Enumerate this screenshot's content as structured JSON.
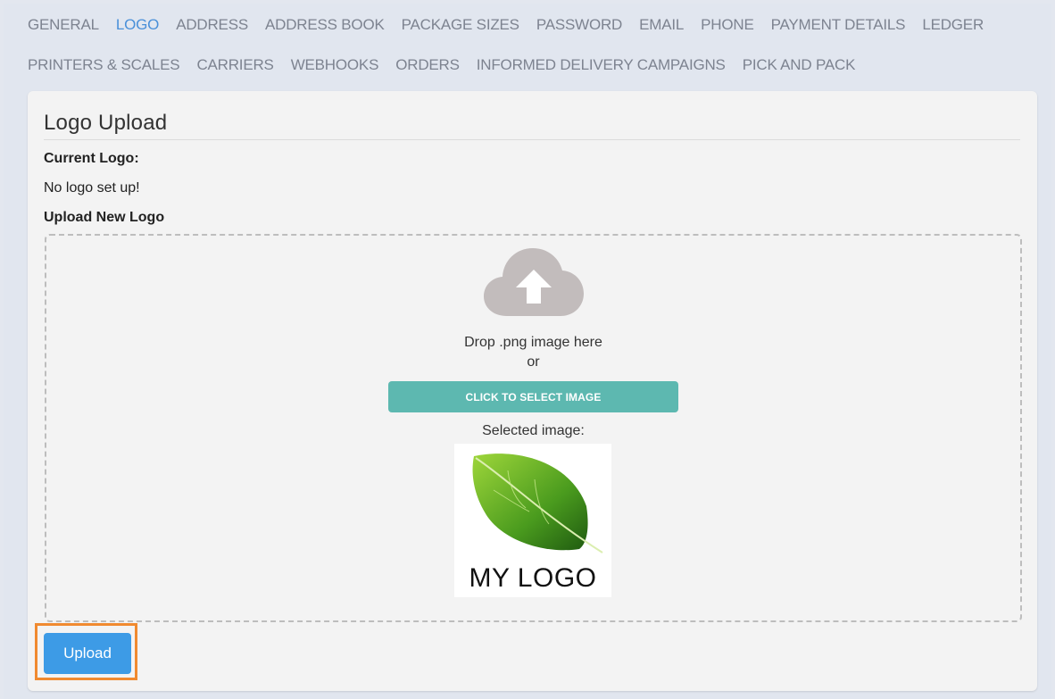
{
  "tabs_row1": [
    "GENERAL",
    "LOGO",
    "ADDRESS",
    "ADDRESS BOOK",
    "PACKAGE SIZES",
    "PASSWORD",
    "EMAIL",
    "PHONE",
    "PAYMENT DETAILS",
    "LEDGER"
  ],
  "tabs_row2": [
    "PRINTERS & SCALES",
    "CARRIERS",
    "WEBHOOKS",
    "ORDERS",
    "INFORMED DELIVERY CAMPAIGNS",
    "PICK AND PACK"
  ],
  "active_tab": "LOGO",
  "card": {
    "title": "Logo Upload",
    "current_logo_label": "Current Logo:",
    "current_logo_value": "No logo set up!",
    "upload_new_label": "Upload New Logo"
  },
  "dropzone": {
    "icon": "cloud-upload-icon",
    "drop_text": "Drop .png image here",
    "or_text": "or",
    "select_button": "CLICK TO SELECT IMAGE",
    "selected_label": "Selected image:",
    "preview_text": "MY LOGO"
  },
  "upload_button": "Upload",
  "colors": {
    "active_tab": "#4a90d9",
    "tab": "#7d8390",
    "select_button": "#5db8b0",
    "upload_button": "#3d9be6",
    "highlight": "#f08a30",
    "cloud": "#c2bcbc"
  }
}
